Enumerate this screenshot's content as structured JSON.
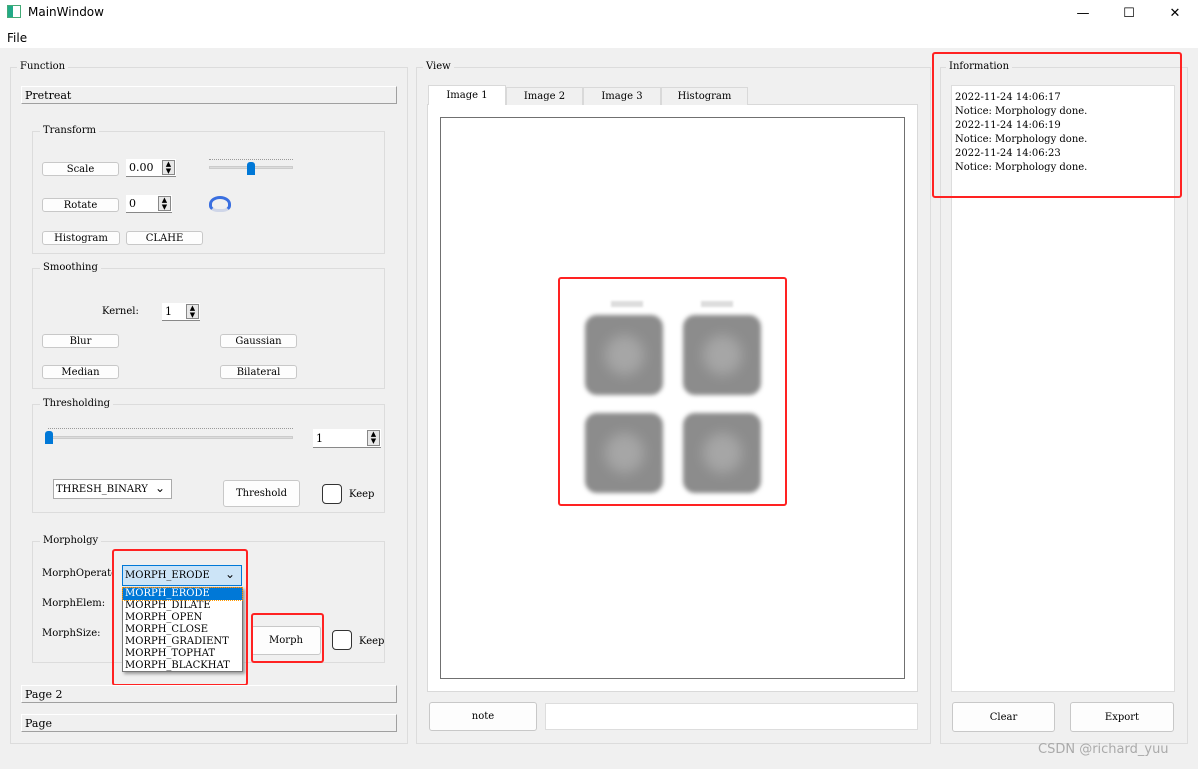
{
  "window": {
    "title": "MainWindow",
    "minimize": "—",
    "maximize": "☐",
    "close": "✕"
  },
  "menu": {
    "file": "File"
  },
  "function": {
    "title": "Function",
    "pretreat": "Pretreat",
    "transform": {
      "title": "Transform",
      "scale": "Scale",
      "scale_value": "0.00",
      "scale_slider_percent": 50,
      "rotate": "Rotate",
      "rotate_value": "0",
      "histogram": "Histogram",
      "clahe": "CLAHE"
    },
    "smoothing": {
      "title": "Smoothing",
      "kernel_label": "Kernel:",
      "kernel_value": "1",
      "blur": "Blur",
      "gaussian": "Gaussian",
      "median": "Median",
      "bilateral": "Bilateral"
    },
    "thresholding": {
      "title": "Thresholding",
      "slider_percent": 0,
      "value": "1",
      "type": "THRESH_BINARY",
      "threshold": "Threshold",
      "keep": "Keep"
    },
    "morphology": {
      "title": "Morpholgy",
      "operator_label": "MorphOperato",
      "elem_label": "MorphElem:",
      "size_label": "MorphSize:",
      "operator_value": "MORPH_ERODE",
      "options": [
        "MORPH_ERODE",
        "MORPH_DILATE",
        "MORPH_OPEN",
        "MORPH_CLOSE",
        "MORPH_GRADIENT",
        "MORPH_TOPHAT",
        "MORPH_BLACKHAT"
      ],
      "morph": "Morph",
      "keep": "Keep"
    },
    "page2": "Page 2",
    "page": "Page"
  },
  "view": {
    "title": "View",
    "tabs": [
      "Image 1",
      "Image 2",
      "Image 3",
      "Histogram"
    ],
    "active_tab": "Image 1",
    "note": "note",
    "note_field": ""
  },
  "information": {
    "title": "Information",
    "log": [
      "2022-11-24 14:06:17",
      "Notice: Morphology done.",
      "2022-11-24 14:06:19",
      "Notice: Morphology done.",
      "2022-11-24 14:06:23",
      "Notice: Morphology done."
    ],
    "clear": "Clear",
    "export": "Export"
  },
  "watermark": "CSDN @richard_yuu",
  "colors": {
    "highlight": "#f22222",
    "accent": "#0078d7"
  }
}
